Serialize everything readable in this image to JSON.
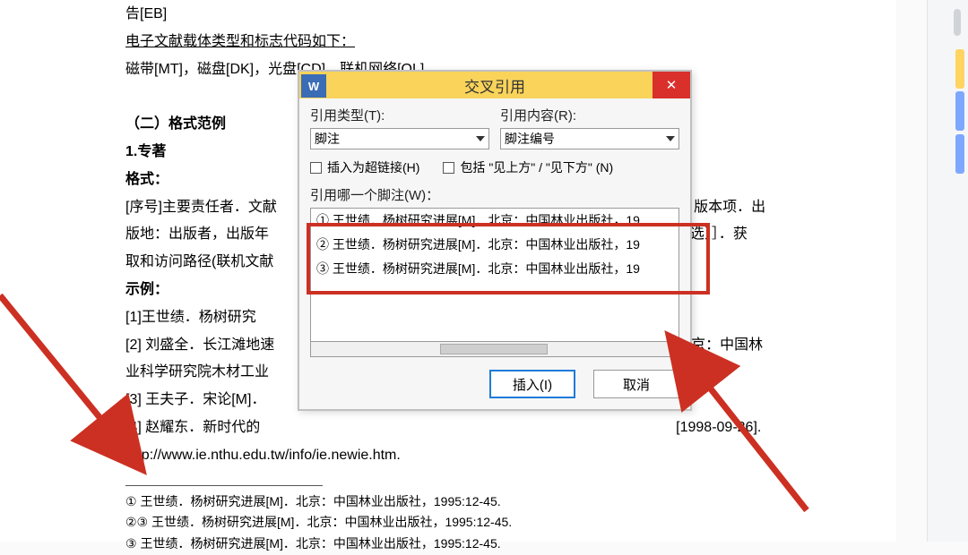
{
  "doc": {
    "l1": "告[EB]",
    "l2": "电子文献载体类型和标志代码如下：",
    "l3": "磁带[MT]，磁盘[DK]，光盘[CD]，联机网络[OL]",
    "h1": "（二）格式范例",
    "h2": "1.专著",
    "h3": "格式：",
    "l4a": "[序号]主要责任者．文献",
    "l4b": ")．版本项．出",
    "l5a": "版地：出版者，出版年",
    "l5b": "任选）］．获",
    "l6": "取和访问路径(联机文献",
    "h4": "示例：",
    "l7": "[1]王世绩．杨树研究",
    "l8a": "[2] 刘盛全．长江滩地速",
    "l8b": "北京：中国林",
    "l9": "业科学研究院木材工业",
    "l10": "[3] 王夫子．宋论[M]．",
    "l11a": "[4] 赵耀东．新时代的",
    "l11b": "[1998-09-26].",
    "l12": "http://www.ie.nthu.edu.tw/info/ie.newie.htm.",
    "fn1_sym": "①",
    "fn12_sym": "②③",
    "fn3_sym": "③",
    "fn_text": " 王世绩．杨树研究进展[M]．北京：中国林业出版社，1995:12-45."
  },
  "dlg": {
    "title": "交叉引用",
    "typel": "引用类型(T):",
    "typeval": "脚注",
    "contl": "引用内容(R):",
    "contval": "脚注编号",
    "chk1": "插入为超链接(H)",
    "chk2": "包括 \"见上方\" / \"见下方\" (N)",
    "whichl": "引用哪一个脚注(W)：",
    "items": [
      "① 王世绩．杨树研究进展[M]．北京：中国林业出版社，19",
      "② 王世绩．杨树研究进展[M]．北京：中国林业出版社，19",
      "③ 王世绩．杨树研究进展[M]．北京：中国林业出版社，19"
    ],
    "btn_insert": "插入(I)",
    "btn_cancel": "取消"
  }
}
